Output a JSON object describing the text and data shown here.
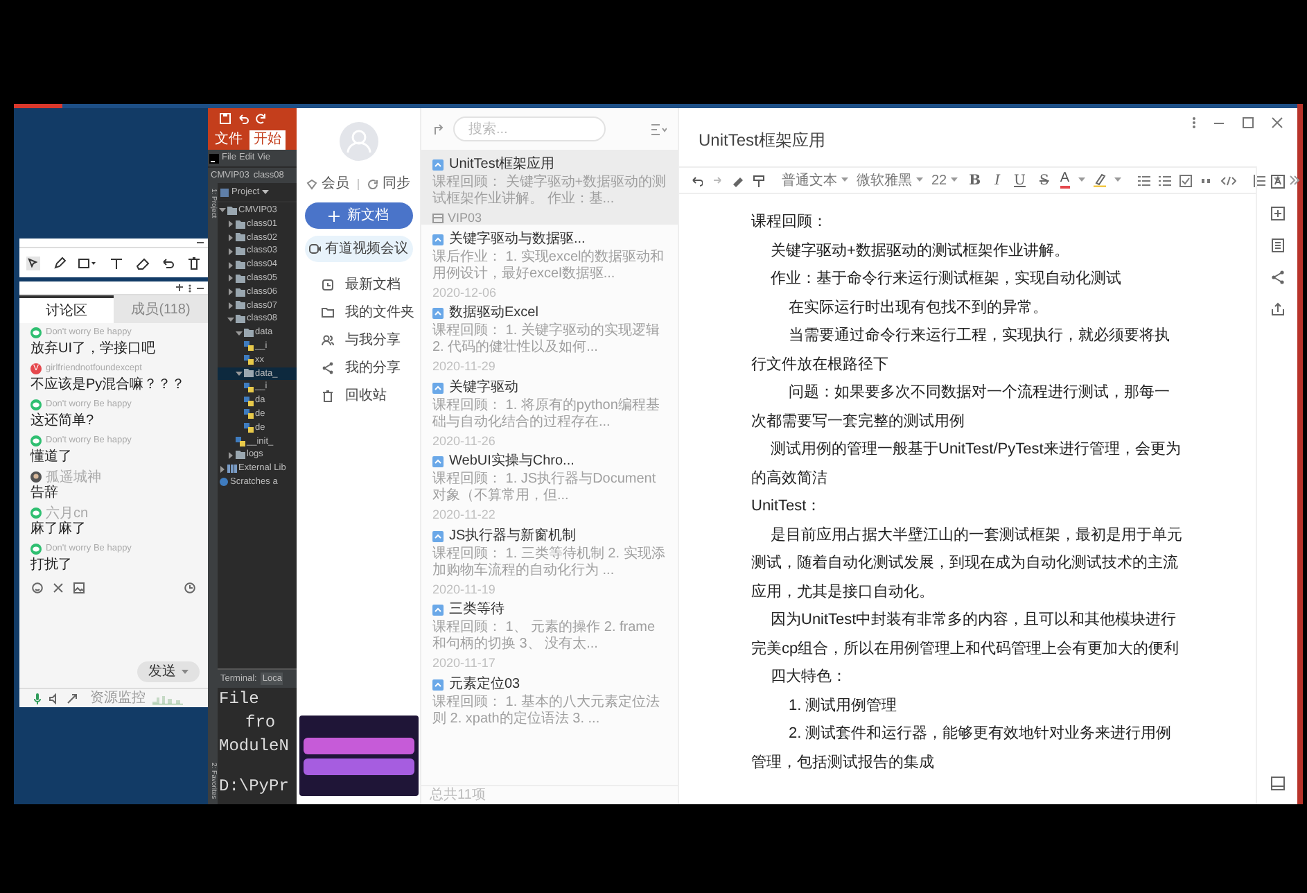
{
  "ide": {
    "ribbon_tabs": [
      {
        "label": "文件",
        "selected": false
      },
      {
        "label": "开始",
        "selected": true
      }
    ],
    "menu": [
      "File",
      "Edit",
      "Vie"
    ],
    "breadcrumb": [
      "CMVIP03",
      "class08"
    ],
    "panel_title": "Project",
    "side_tabs": [
      "1: Project",
      "2: Favorites"
    ],
    "tree": [
      {
        "label": "CMVIP03",
        "kind": "folder",
        "expanded": true,
        "selected": false,
        "children": [
          {
            "label": "class01",
            "kind": "folder",
            "expanded": false,
            "selected": false
          },
          {
            "label": "class02",
            "kind": "folder",
            "expanded": false,
            "selected": false
          },
          {
            "label": "class03",
            "kind": "folder",
            "expanded": false,
            "selected": false
          },
          {
            "label": "class04",
            "kind": "folder",
            "expanded": false,
            "selected": false
          },
          {
            "label": "class05",
            "kind": "folder",
            "expanded": false,
            "selected": false
          },
          {
            "label": "class06",
            "kind": "folder",
            "expanded": false,
            "selected": false
          },
          {
            "label": "class07",
            "kind": "folder",
            "expanded": false,
            "selected": false
          },
          {
            "label": "class08",
            "kind": "folder",
            "expanded": true,
            "selected": false,
            "children": [
              {
                "label": "data",
                "kind": "folder",
                "expanded": true,
                "selected": false,
                "children": [
                  {
                    "label": "__i",
                    "kind": "python",
                    "selected": false
                  },
                  {
                    "label": "xx",
                    "kind": "python",
                    "selected": false
                  }
                ]
              },
              {
                "label": "data_",
                "kind": "folder",
                "expanded": true,
                "selected": true,
                "children": [
                  {
                    "label": "__i",
                    "kind": "python",
                    "selected": false
                  },
                  {
                    "label": "da",
                    "kind": "python",
                    "selected": false
                  },
                  {
                    "label": "de",
                    "kind": "python",
                    "selected": false
                  },
                  {
                    "label": "de",
                    "kind": "python",
                    "selected": false
                  }
                ]
              },
              {
                "label": "__init_",
                "kind": "python",
                "selected": false
              }
            ]
          },
          {
            "label": "logs",
            "kind": "folder",
            "expanded": false,
            "selected": false
          }
        ]
      },
      {
        "label": "External Lib",
        "kind": "library",
        "expanded": false,
        "selected": false
      },
      {
        "label": "Scratches a",
        "kind": "scratch",
        "selected": false
      }
    ],
    "terminal": {
      "tabs": [
        {
          "label": "Terminal:",
          "selected": false
        },
        {
          "label": "Loca",
          "selected": true
        }
      ],
      "lines": [
        "File",
        "fro",
        "ModuleN",
        "D:\\PyPr"
      ]
    }
  },
  "chat": {
    "tabs": [
      {
        "label": "讨论区",
        "selected": true
      },
      {
        "label": "成员(118)",
        "selected": false
      }
    ],
    "messages": [
      {
        "kind": "wechat",
        "user": "Don't worry Be happy",
        "text": "放弃UI了，学接口吧"
      },
      {
        "kind": "letter",
        "initial": "V",
        "user": "girlfriendnotfoundexcept",
        "text": "不应该是Py混合嘛？？？"
      },
      {
        "kind": "wechat",
        "user": "Don't worry Be happy",
        "text": "这还简单?"
      },
      {
        "kind": "wechat",
        "user": "Don't worry Be happy",
        "text": "懂道了"
      },
      {
        "kind": "photo",
        "user": "孤遥城神",
        "text": "告辞"
      },
      {
        "kind": "wechat",
        "user": "六月cn",
        "text": "麻了麻了"
      },
      {
        "kind": "wechat",
        "user": "Don't worry Be happy",
        "text": "打扰了"
      }
    ],
    "send_button": "发送",
    "monitor_label": "资源监控"
  },
  "notes": {
    "sidebar": {
      "member_label": "会员",
      "sync_label": "同步",
      "new_button": "新文档",
      "meeting_button": "有道视频会议",
      "nav": [
        {
          "label": "最新文档",
          "selected": false
        },
        {
          "label": "我的文件夹",
          "selected": false
        },
        {
          "label": "与我分享",
          "selected": false
        },
        {
          "label": "我的分享",
          "selected": false
        },
        {
          "label": "回收站",
          "selected": false
        }
      ]
    },
    "list": {
      "search_placeholder": "搜索...",
      "items": [
        {
          "title": "UnitTest框架应用",
          "snippet": "课程回顾： 关键字驱动+数据驱动的测试框架作业讲解。 作业：基...",
          "meta": "VIP03",
          "kind": "tag",
          "selected": true
        },
        {
          "title": "关键字驱动与数据驱...",
          "snippet": "课后作业： 1. 实现excel的数据驱动和用例设计，最好excel数据驱...",
          "meta": "2020-12-06",
          "kind": "date",
          "selected": false
        },
        {
          "title": "数据驱动Excel",
          "snippet": "课程回顾： 1. 关键字驱动的实现逻辑 2. 代码的健壮性以及如何...",
          "meta": "2020-11-29",
          "kind": "date",
          "selected": false
        },
        {
          "title": "关键字驱动",
          "snippet": "课程回顾： 1. 将原有的python编程基础与自动化结合的过程存在...",
          "meta": "2020-11-26",
          "kind": "date",
          "selected": false
        },
        {
          "title": "WebUI实操与Chro...",
          "snippet": "课程回顾： 1. JS执行器与Document对象（不算常用，但...",
          "meta": "2020-11-22",
          "kind": "date",
          "selected": false
        },
        {
          "title": "JS执行器与新窗机制",
          "snippet": "课程回顾： 1. 三类等待机制 2. 实现添加购物车流程的自动化行为 ...",
          "meta": "2020-11-19",
          "kind": "date",
          "selected": false
        },
        {
          "title": "三类等待",
          "snippet": "课程回顾： 1、 元素的操作 2. frame和句柄的切换 3、 没有太...",
          "meta": "2020-11-17",
          "kind": "date",
          "selected": false
        },
        {
          "title": "元素定位03",
          "snippet": "课程回顾： 1. 基本的八大元素定位法则 2. xpath的定位语法 3. ...",
          "selected": false
        }
      ],
      "footer": "总共11项"
    },
    "editor": {
      "title": "UnitTest框架应用",
      "toolbar": {
        "style": "普通文本",
        "font": "微软雅黑",
        "size": "22",
        "format_buttons": [
          "B",
          "I",
          "U",
          "S"
        ],
        "color_button": "A"
      },
      "paragraphs": [
        {
          "kind": "plain",
          "text": "课程回顾："
        },
        {
          "kind": "indent",
          "text": "关键字驱动+数据驱动的测试框架作业讲解。"
        },
        {
          "kind": "indent",
          "text": "作业：基于命令行来运行测试框架，实现自动化测试"
        },
        {
          "kind": "indent2",
          "text": "在实际运行时出现有包找不到的异常。"
        },
        {
          "kind": "indent2",
          "text": "当需要通过命令行来运行工程，实现执行，就必须要将执行文件放在根路径下"
        },
        {
          "kind": "indent2",
          "text": "问题：如果要多次不同数据对一个流程进行测试，那每一次都需要写一套完整的测试用例"
        },
        {
          "kind": "indent",
          "text": "测试用例的管理一般基于UnitTest/PyTest来进行管理，会更为的高效简洁"
        },
        {
          "kind": "plain",
          "text": "UnitTest："
        },
        {
          "kind": "indent",
          "text": "是目前应用占据大半壁江山的一套测试框架，最初是用于单元测试，随着自动化测试发展，到现在成为自动化测试技术的主流应用，尤其是接口自动化。"
        },
        {
          "kind": "indent",
          "text": "因为UnitTest中封装有非常多的内容，且可以和其他模块进行完美cp组合，所以在用例管理上和代码管理上会有更加大的便利"
        },
        {
          "kind": "indent",
          "text": "四大特色："
        },
        {
          "kind": "indent2",
          "text": "1. 测试用例管理"
        },
        {
          "kind": "indent2",
          "text": "2. 测试套件和运行器，能够更有效地针对业务来进行用例管理，包括测试报告的集成"
        }
      ]
    }
  }
}
